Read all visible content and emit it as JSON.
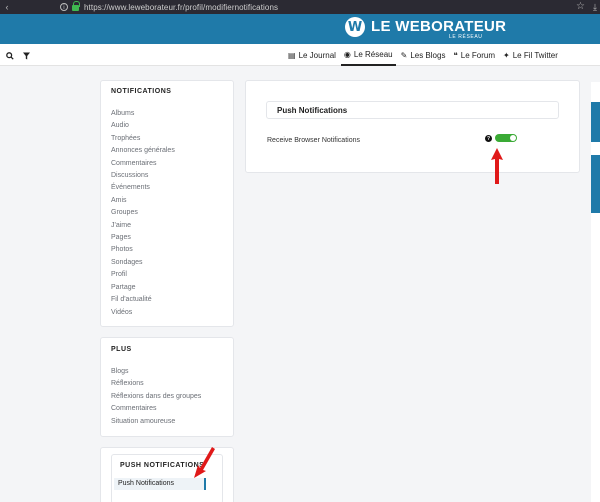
{
  "browser": {
    "url": "https://www.leweborateur.fr/profil/modifiernotifications"
  },
  "brand": {
    "logo_letter": "W",
    "name": "LE WEBORATEUR",
    "subtitle": "LE RÉSEAU",
    "color": "#1f7aa9"
  },
  "nav": {
    "items": [
      {
        "icon": "newspaper-icon",
        "glyph": "▤",
        "label": "Le Journal"
      },
      {
        "icon": "globe-icon",
        "glyph": "◉",
        "label": "Le Réseau"
      },
      {
        "icon": "pencil-icon",
        "glyph": "✎",
        "label": "Les Blogs"
      },
      {
        "icon": "comments-icon",
        "glyph": "❝",
        "label": "Le Forum"
      },
      {
        "icon": "twitter-icon",
        "glyph": "✦",
        "label": "Le Fil Twitter"
      }
    ]
  },
  "sidebar": {
    "notifications": {
      "title": "NOTIFICATIONS",
      "items": [
        "Albums",
        "Audio",
        "Trophées",
        "Annonces générales",
        "Commentaires",
        "Discussions",
        "Événements",
        "Amis",
        "Groupes",
        "J'aime",
        "Pages",
        "Photos",
        "Sondages",
        "Profil",
        "Partage",
        "Fil d'actualité",
        "Vidéos"
      ]
    },
    "plus": {
      "title": "PLUS",
      "items": [
        "Blogs",
        "Réflexions",
        "Réflexions dans des groupes",
        "Commentaires",
        "Situation amoureuse"
      ]
    },
    "push": {
      "title": "PUSH NOTIFICATIONS",
      "items": [
        "Push Notifications"
      ]
    }
  },
  "main": {
    "title": "Push Notifications",
    "setting_label": "Receive Browser Notifications",
    "help_glyph": "?",
    "toggle_on": true,
    "toggle_color": "#3aaa35"
  },
  "annotation_color": "#e01919"
}
